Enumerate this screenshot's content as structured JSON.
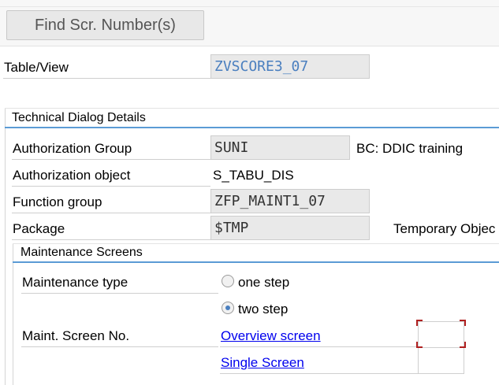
{
  "toolbar": {
    "find_button": "Find Scr. Number(s)"
  },
  "header": {
    "table_view_label": "Table/View",
    "table_view_value": "ZVSCORE3_07"
  },
  "technical": {
    "title": "Technical Dialog Details",
    "auth_group_label": "Authorization Group",
    "auth_group_value": "SUNI",
    "auth_group_desc": "BC: DDIC training",
    "auth_object_label": "Authorization object",
    "auth_object_value": "S_TABU_DIS",
    "function_group_label": "Function group",
    "function_group_value": "ZFP_MAINT1_07",
    "package_label": "Package",
    "package_value": "$TMP",
    "package_desc": "Temporary Objec"
  },
  "maintenance": {
    "title": "Maintenance Screens",
    "type_label": "Maintenance type",
    "one_step": "one step",
    "two_step": "two step",
    "selected": "two step",
    "screen_no_label": "Maint. Screen No.",
    "overview_link": "Overview screen",
    "single_link": "Single Screen",
    "overview_value": "",
    "single_value": ""
  },
  "colors": {
    "accent": "#5b9bd5",
    "link": "#0000ee",
    "field_bg": "#e9e9e9",
    "focus": "#b02020"
  }
}
